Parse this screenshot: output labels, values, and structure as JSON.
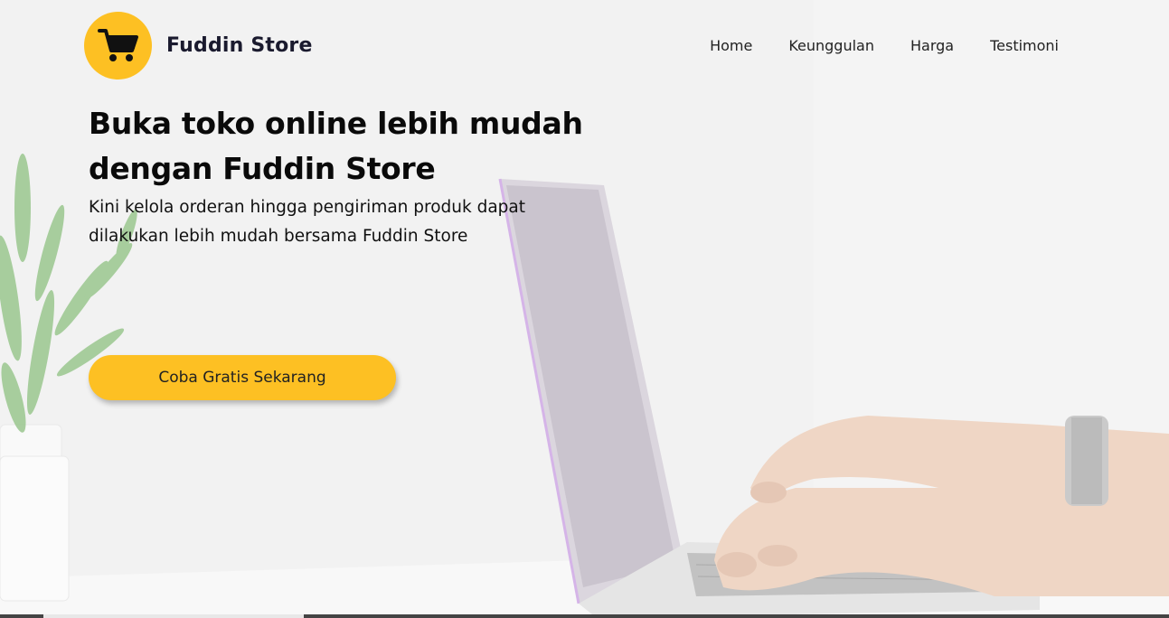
{
  "brand": {
    "name": "Fuddin Store",
    "logo_icon": "shopping-cart-icon",
    "logo_color": "#fdc023"
  },
  "nav": {
    "items": [
      {
        "label": "Home"
      },
      {
        "label": "Keunggulan"
      },
      {
        "label": "Harga"
      },
      {
        "label": "Testimoni"
      }
    ]
  },
  "hero": {
    "title_line1": "Buka toko online lebih mudah",
    "title_line2": "dengan Fuddin Store",
    "subtitle_line1": "Kini kelola orderan hingga pengiriman produk dapat",
    "subtitle_line2": "dilakukan lebih mudah bersama Fuddin Store",
    "cta_label": "Coba Gratis Sekarang",
    "accent": "#fdc023"
  }
}
